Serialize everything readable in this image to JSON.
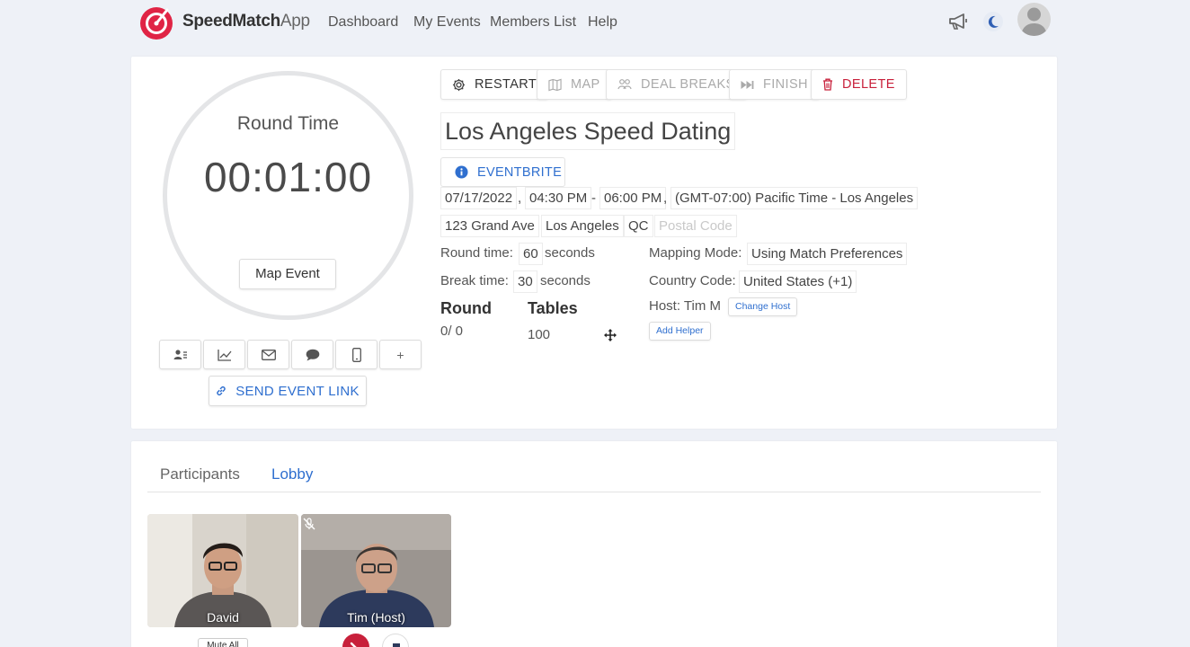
{
  "brand": {
    "name_bold": "SpeedMatch",
    "name_light": "App",
    "accent": "#e02445"
  },
  "nav": {
    "links": [
      "Dashboard",
      "My Events",
      "Members List",
      "Help"
    ]
  },
  "timer": {
    "label": "Round Time",
    "value": "00:01:00",
    "map_event": "Map Event"
  },
  "toolbar": {
    "send_event_link": "SEND EVENT LINK",
    "add": "+"
  },
  "actions": {
    "restart": "RESTART",
    "map": "MAP",
    "deal_breaks": "DEAL BREAKS",
    "finish": "FINISH",
    "delete": "DELETE"
  },
  "event": {
    "title": "Los Angeles Speed Dating",
    "eventbrite": "EVENTBRITE",
    "date": "07/17/2022",
    "start_time": "04:30 PM",
    "end_time": "06:00 PM",
    "timezone": "(GMT-07:00) Pacific Time - Los Angeles",
    "address": "123 Grand Ave",
    "city": "Los Angeles",
    "region": "QC",
    "postal_code_placeholder": "Postal Code",
    "comma": ",",
    "dash": "-"
  },
  "settings": {
    "round_time_label": "Round time:",
    "round_time_value": "60",
    "round_time_unit": "seconds",
    "break_time_label": "Break time:",
    "break_time_value": "30",
    "break_time_unit": "seconds",
    "mapping_mode_label": "Mapping Mode:",
    "mapping_mode_value": "Using Match Preferences",
    "country_code_label": "Country Code:",
    "country_code_value": "United States (+1)",
    "host_label": "Host: Tim M",
    "change_host": "Change Host",
    "add_helper": "Add Helper"
  },
  "stats": {
    "round_label": "Round",
    "round_value": "0/ 0",
    "tables_label": "Tables",
    "tables_value": "100"
  },
  "tabs": {
    "participants": "Participants",
    "lobby": "Lobby",
    "active_color": "#2f6fcf"
  },
  "lobby": {
    "videos": [
      {
        "name": "David"
      },
      {
        "name": "Tim (Host)"
      }
    ],
    "mute_all": "Mute All"
  }
}
